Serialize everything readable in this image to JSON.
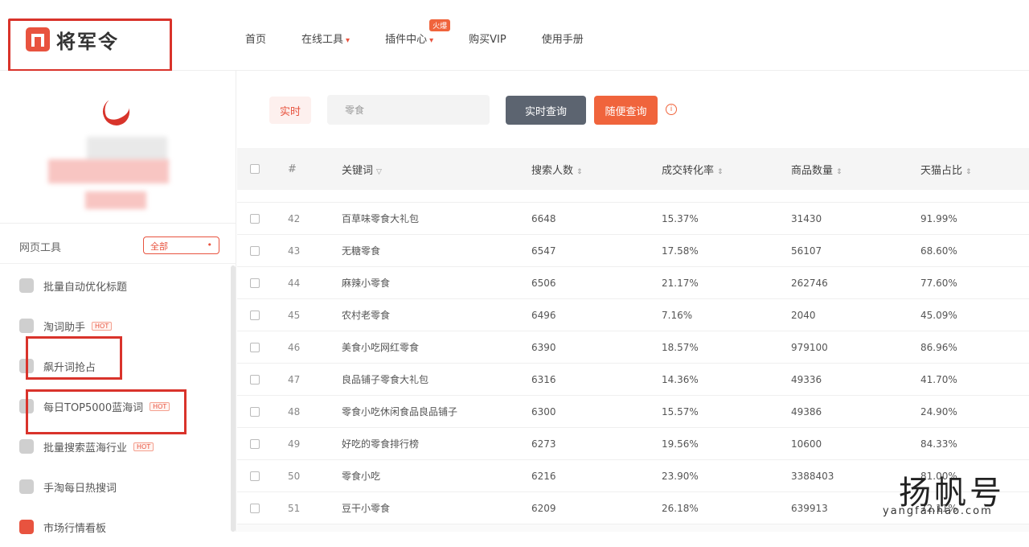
{
  "brand": {
    "name": "将军令"
  },
  "nav": {
    "items": [
      {
        "label": "首页",
        "dot": false
      },
      {
        "label": "在线工具",
        "dot": true
      },
      {
        "label": "插件中心",
        "dot": true
      },
      {
        "label": "购买VIP",
        "dot": false
      },
      {
        "label": "使用手册",
        "dot": false
      }
    ],
    "badge": "火爆"
  },
  "sidebar": {
    "tools_title": "网页工具",
    "filter_value": "全部",
    "tools": [
      {
        "label": "批量自动优化标题",
        "hot": false,
        "icon": "tool-icon"
      },
      {
        "label": "淘词助手",
        "hot": true,
        "icon": "tool-icon"
      },
      {
        "label": "飙升词抢占",
        "hot": false,
        "icon": "tool-icon"
      },
      {
        "label": "每日TOP5000蓝海词",
        "hot": true,
        "icon": "tool-icon"
      },
      {
        "label": "批量搜索蓝海行业",
        "hot": true,
        "icon": "tool-icon"
      },
      {
        "label": "手淘每日热搜词",
        "hot": false,
        "icon": "tool-icon"
      },
      {
        "label": "市场行情看板",
        "hot": false,
        "icon": "tool-icon"
      }
    ],
    "hot_label": "HOT"
  },
  "search": {
    "realtime_label": "实时",
    "keyword_value": "零食",
    "query_button": "实时查询",
    "random_button": "随便查询"
  },
  "table": {
    "headers": [
      "#",
      "关键词",
      "搜索人数",
      "成交转化率",
      "商品数量",
      "天猫占比"
    ],
    "rows": [
      [
        "42",
        "百草味零食大礼包",
        "6648",
        "15.37%",
        "31430",
        "91.99%"
      ],
      [
        "43",
        "无糖零食",
        "6547",
        "17.58%",
        "56107",
        "68.60%"
      ],
      [
        "44",
        "麻辣小零食",
        "6506",
        "21.17%",
        "262746",
        "77.60%"
      ],
      [
        "45",
        "农村老零食",
        "6496",
        "7.16%",
        "2040",
        "45.09%"
      ],
      [
        "46",
        "美食小吃网红零食",
        "6390",
        "18.57%",
        "979100",
        "86.96%"
      ],
      [
        "47",
        "良品铺子零食大礼包",
        "6316",
        "14.36%",
        "49336",
        "41.70%"
      ],
      [
        "48",
        "零食小吃休闲食品良品铺子",
        "6300",
        "15.57%",
        "49386",
        "24.90%"
      ],
      [
        "49",
        "好吃的零食排行榜",
        "6273",
        "19.56%",
        "10600",
        "84.33%"
      ],
      [
        "50",
        "零食小吃",
        "6216",
        "23.90%",
        "3388403",
        "81.00%"
      ],
      [
        "51",
        "豆干小零食",
        "6209",
        "26.18%",
        "639913",
        "72.11%"
      ]
    ]
  },
  "watermark": {
    "main": "扬帆号",
    "sub": "yangfanhao.com"
  }
}
